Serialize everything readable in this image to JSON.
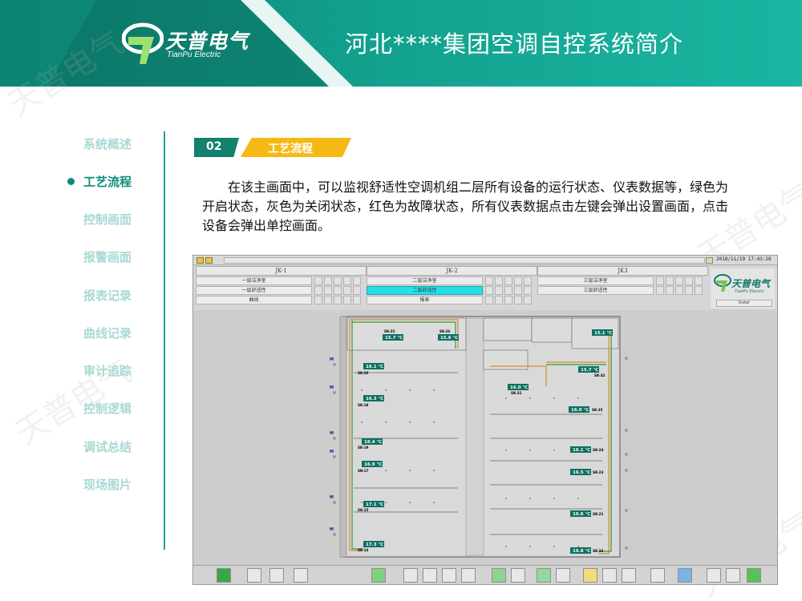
{
  "header": {
    "logo_cn": "天普电气",
    "logo_en": "TianPu Electric",
    "title": "河北****集团空调自控系统简介",
    "colors": {
      "primary": "#12a08d",
      "dark": "#0e7f6f",
      "accent": "#f6b913"
    }
  },
  "sidenav": {
    "items": [
      {
        "label": "系统概述",
        "active": false
      },
      {
        "label": "工艺流程",
        "active": true
      },
      {
        "label": "控制画面",
        "active": false
      },
      {
        "label": "报警画面",
        "active": false
      },
      {
        "label": "报表记录",
        "active": false
      },
      {
        "label": "曲线记录",
        "active": false
      },
      {
        "label": "审计追踪",
        "active": false
      },
      {
        "label": "控制逻辑",
        "active": false
      },
      {
        "label": "调试总结",
        "active": false
      },
      {
        "label": "现场图片",
        "active": false
      }
    ]
  },
  "section": {
    "number": "02",
    "title": "工艺流程"
  },
  "description": "在该主画面中，可以监视舒适性空调机组二层所有设备的运行状态、仪表数据等，绿色为开启状态，灰色为关闭状态，红色为故障状态，所有仪表数据点击左键会弹出设置画面，点击设备会弹出单控画面。",
  "watermark": "天普电气",
  "scada": {
    "datetime": "2018/11/19 17:43:28",
    "user": "Inster",
    "logo_cn": "天普电气",
    "logo_en": "TianPu Electric",
    "units": [
      {
        "name": "JK-1",
        "rows": [
          "一层洁净室",
          "一层舒适性",
          "曲线"
        ]
      },
      {
        "name": "JK-2",
        "rows": [
          "二层洁净室",
          "二层舒适性",
          "报表"
        ]
      },
      {
        "name": "JK3",
        "rows": [
          "三层洁净室",
          "三层舒适性",
          ""
        ]
      }
    ],
    "active_row": "二层舒适性",
    "sensors": [
      {
        "temp": "15.7 ℃",
        "sk": "SK-25"
      },
      {
        "temp": "15.6 ℃",
        "sk": "SK-26"
      },
      {
        "temp": "15.1 ℃",
        "sk": ""
      },
      {
        "temp": "16.1 ℃",
        "sk": "SK-20"
      },
      {
        "temp": "15.7 ℃",
        "sk": "SK-32"
      },
      {
        "temp": "16.0 ℃",
        "sk": "SK-31"
      },
      {
        "temp": "16.3 ℃",
        "sk": "SK-18"
      },
      {
        "temp": "16.0 ℃",
        "sk": "SK-25"
      },
      {
        "temp": "16.4 ℃",
        "sk": "SK-19"
      },
      {
        "temp": "16.1 ℃",
        "sk": "SK-24"
      },
      {
        "temp": "16.9 ℃",
        "sk": "SK-17"
      },
      {
        "temp": "16.5 ℃",
        "sk": "SK-23"
      },
      {
        "temp": "17.1 ℃",
        "sk": "SK-15"
      },
      {
        "temp": "16.6 ℃",
        "sk": "SK-21"
      },
      {
        "temp": "17.3 ℃",
        "sk": "SK-14"
      },
      {
        "temp": "16.8 ℃",
        "sk": "SK-22"
      }
    ]
  }
}
